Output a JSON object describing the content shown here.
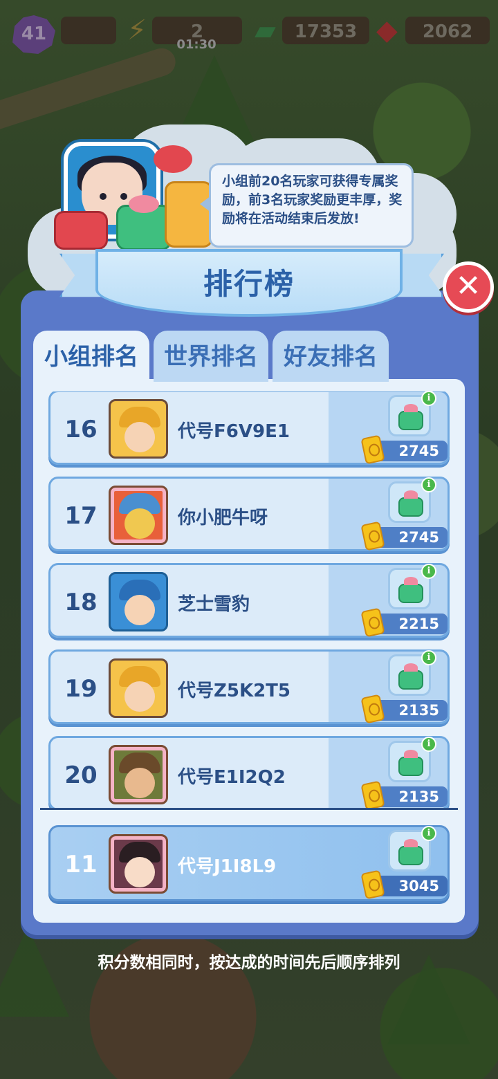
{
  "hud": {
    "level": "41",
    "energy": "2",
    "energy_timer": "01:30",
    "coins": "17353",
    "gems": "2062"
  },
  "tip": {
    "text": "小组前20名玩家可获得专属奖励，前3名玩家奖励更丰厚，奖励将在活动结束后发放!"
  },
  "title": "排行榜",
  "tabs": [
    {
      "label": "小组排名",
      "active": true
    },
    {
      "label": "世界排名",
      "active": false
    },
    {
      "label": "好友排名",
      "active": false
    }
  ],
  "rows": [
    {
      "rank": "16",
      "name": "代号F6V9E1",
      "score": "2745",
      "avatar": "detective-avatar"
    },
    {
      "rank": "17",
      "name": "你小肥牛呀",
      "score": "2745",
      "avatar": "red-dragon-avatar"
    },
    {
      "rank": "18",
      "name": "芝士雪豹",
      "score": "2215",
      "avatar": "clown-avatar"
    },
    {
      "rank": "19",
      "name": "代号Z5K2T5",
      "score": "2135",
      "avatar": "detective-avatar"
    },
    {
      "rank": "20",
      "name": "代号E1I2Q2",
      "score": "2135",
      "avatar": "pilot-avatar"
    }
  ],
  "self": {
    "rank": "11",
    "name": "代号J1I8L9",
    "score": "3045",
    "avatar": "girl-avatar"
  },
  "footnote": "积分数相同时，按达成的时间先后顺序排列",
  "close_label": "✕"
}
